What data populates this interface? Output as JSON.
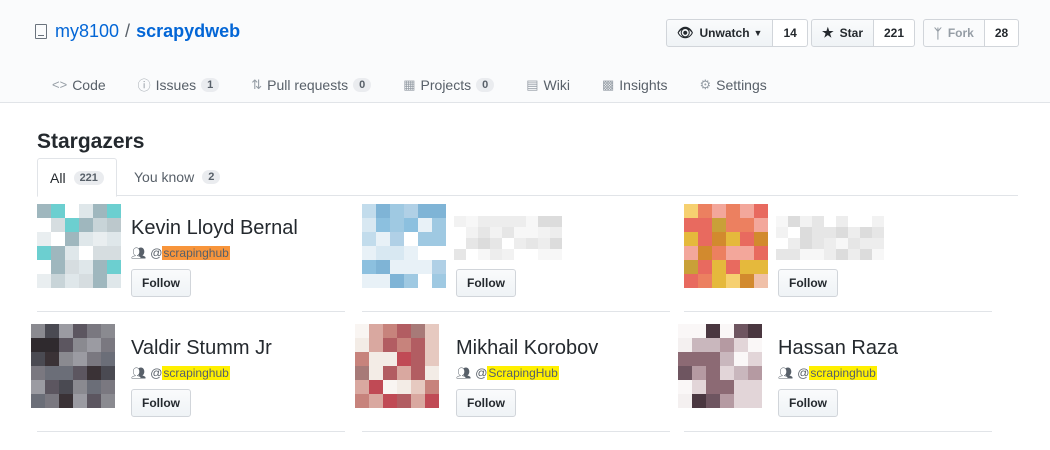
{
  "repo": {
    "owner": "my8100",
    "separator": "/",
    "name": "scrapydweb"
  },
  "actions": {
    "watch": {
      "label": "Unwatch",
      "icon": "eye-icon",
      "count": "14"
    },
    "star": {
      "label": "Star",
      "icon": "star-icon",
      "count": "221"
    },
    "fork": {
      "label": "Fork",
      "icon": "fork-icon",
      "count": "28"
    }
  },
  "tabs": [
    {
      "label": "Code",
      "icon": "code-icon",
      "count": null
    },
    {
      "label": "Issues",
      "icon": "issue-icon",
      "count": "1"
    },
    {
      "label": "Pull requests",
      "icon": "pull-request-icon",
      "count": "0"
    },
    {
      "label": "Projects",
      "icon": "project-icon",
      "count": "0"
    },
    {
      "label": "Wiki",
      "icon": "wiki-icon",
      "count": null
    },
    {
      "label": "Insights",
      "icon": "graph-icon",
      "count": null
    },
    {
      "label": "Settings",
      "icon": "gear-icon",
      "count": null
    }
  ],
  "page_title": "Stargazers",
  "subtabs": [
    {
      "label": "All",
      "count": "221"
    },
    {
      "label": "You know",
      "count": "2"
    }
  ],
  "follow_label": "Follow",
  "org_prefix": "@",
  "colors": {
    "highlight_orange": "#f8953b",
    "highlight_yellow": "#fff000"
  },
  "stargazers": [
    {
      "name": "Kevin Lloyd Bernal",
      "org": "scrapinghub",
      "highlight": "orange"
    },
    {
      "name": "",
      "org": "",
      "highlight": "none"
    },
    {
      "name": "",
      "org": "",
      "highlight": "none"
    },
    {
      "name": "Valdir Stumm Jr",
      "org": "scrapinghub",
      "highlight": "yellow"
    },
    {
      "name": "Mikhail Korobov",
      "org": "ScrapingHub",
      "highlight": "yellow"
    },
    {
      "name": "Hassan Raza",
      "org": "scrapinghub",
      "highlight": "yellow"
    }
  ]
}
